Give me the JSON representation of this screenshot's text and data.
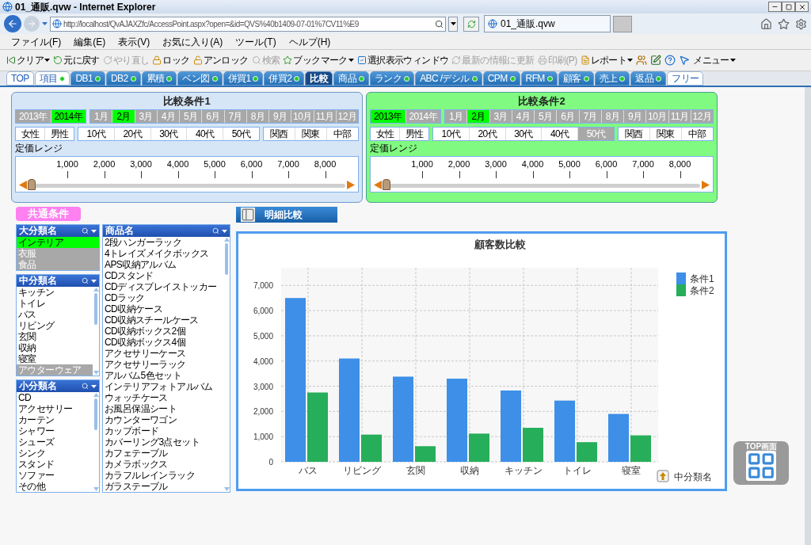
{
  "window": {
    "title": "01_通販.qvw - Internet Explorer"
  },
  "browser": {
    "url": "http://localhost/QvAJAXZfc/AccessPoint.aspx?open=&id=QVS%40b1409-07-01%7CV11%E9",
    "tab_title": "01_通販.qvw",
    "menu": [
      "ファイル(F)",
      "編集(E)",
      "表示(V)",
      "お気に入り(A)",
      "ツール(T)",
      "ヘルプ(H)"
    ]
  },
  "toolbar": [
    {
      "kind": "labeled",
      "label": "クリア",
      "disabled": false,
      "dropdown": true
    },
    {
      "kind": "labeled",
      "label": "元に戻す",
      "disabled": false,
      "dropdown": false
    },
    {
      "kind": "labeled",
      "label": "やり直し",
      "disabled": true,
      "dropdown": false
    },
    {
      "kind": "labeled",
      "label": "ロック",
      "disabled": false,
      "dropdown": false
    },
    {
      "kind": "labeled",
      "label": "アンロック",
      "disabled": false,
      "dropdown": false
    },
    {
      "kind": "labeled",
      "label": "検索",
      "disabled": true,
      "dropdown": false
    },
    {
      "kind": "labeled",
      "label": "ブックマーク",
      "disabled": false,
      "dropdown": true
    },
    {
      "kind": "labeled",
      "label": "選択表示ウィンドウ",
      "disabled": false,
      "dropdown": false
    },
    {
      "kind": "labeled",
      "label": "最新の情報に更新",
      "disabled": true,
      "dropdown": false
    },
    {
      "kind": "labeled",
      "label": "印刷(P)",
      "disabled": true,
      "dropdown": false
    },
    {
      "kind": "labeled",
      "label": "レポート",
      "disabled": false,
      "dropdown": true
    },
    {
      "kind": "icon",
      "disabled": false
    },
    {
      "kind": "icon",
      "disabled": false
    },
    {
      "kind": "icon",
      "disabled": false
    },
    {
      "kind": "icon",
      "disabled": false
    },
    {
      "kind": "labeled",
      "label": "メニュー",
      "disabled": false,
      "dropdown": true
    }
  ],
  "tabs": [
    {
      "label": "TOP",
      "kind": "light",
      "selected": false,
      "dot": false
    },
    {
      "label": "項目",
      "kind": "light",
      "selected": false,
      "dot": true
    },
    {
      "label": "DB1",
      "kind": "blue",
      "selected": false,
      "dot": true
    },
    {
      "label": "DB2",
      "kind": "blue",
      "selected": false,
      "dot": true
    },
    {
      "label": "累積",
      "kind": "blue",
      "selected": false,
      "dot": true
    },
    {
      "label": "ベン図",
      "kind": "blue",
      "selected": false,
      "dot": true
    },
    {
      "label": "併買1",
      "kind": "blue",
      "selected": false,
      "dot": true
    },
    {
      "label": "併買2",
      "kind": "blue",
      "selected": false,
      "dot": true
    },
    {
      "label": "比較",
      "kind": "blue",
      "selected": true,
      "dot": false
    },
    {
      "label": "商品",
      "kind": "blue",
      "selected": false,
      "dot": true
    },
    {
      "label": "ランク",
      "kind": "blue",
      "selected": false,
      "dot": true
    },
    {
      "label": "ABC /デシル",
      "kind": "blue",
      "selected": false,
      "dot": true
    },
    {
      "label": "CPM",
      "kind": "blue",
      "selected": false,
      "dot": true
    },
    {
      "label": "RFM",
      "kind": "blue",
      "selected": false,
      "dot": true
    },
    {
      "label": "顧客",
      "kind": "blue",
      "selected": false,
      "dot": true
    },
    {
      "label": "売上",
      "kind": "blue",
      "selected": false,
      "dot": true
    },
    {
      "label": "返品",
      "kind": "blue",
      "selected": false,
      "dot": true
    },
    {
      "label": "フリー",
      "kind": "light",
      "selected": false,
      "dot": false
    }
  ],
  "conditions": [
    {
      "title": "比較条件1",
      "color": "#d6e6f7",
      "years": [
        {
          "label": "2013年",
          "selected": false,
          "excluded": true
        },
        {
          "label": "2014年",
          "selected": true,
          "excluded": false
        }
      ],
      "months": [
        {
          "label": "1月",
          "selected": false,
          "excluded": true
        },
        {
          "label": "2月",
          "selected": true,
          "excluded": false
        },
        {
          "label": "3月",
          "selected": false,
          "excluded": true
        },
        {
          "label": "4月",
          "selected": false,
          "excluded": true
        },
        {
          "label": "5月",
          "selected": false,
          "excluded": true
        },
        {
          "label": "6月",
          "selected": false,
          "excluded": true
        },
        {
          "label": "7月",
          "selected": false,
          "excluded": true
        },
        {
          "label": "8月",
          "selected": false,
          "excluded": true
        },
        {
          "label": "9月",
          "selected": false,
          "excluded": true
        },
        {
          "label": "10月",
          "selected": false,
          "excluded": true
        },
        {
          "label": "11月",
          "selected": false,
          "excluded": true
        },
        {
          "label": "12月",
          "selected": false,
          "excluded": true
        }
      ],
      "genders": [
        {
          "label": "女性",
          "selected": false,
          "excluded": false
        },
        {
          "label": "男性",
          "selected": false,
          "excluded": false
        }
      ],
      "ages": [
        {
          "label": "10代",
          "selected": false,
          "excluded": false
        },
        {
          "label": "20代",
          "selected": false,
          "excluded": false
        },
        {
          "label": "30代",
          "selected": false,
          "excluded": false
        },
        {
          "label": "40代",
          "selected": false,
          "excluded": false
        },
        {
          "label": "50代",
          "selected": false,
          "excluded": false
        }
      ],
      "regions": [
        {
          "label": "関西",
          "selected": false,
          "excluded": false
        },
        {
          "label": "関東",
          "selected": false,
          "excluded": false
        },
        {
          "label": "中部",
          "selected": false,
          "excluded": false
        }
      ],
      "range_label": "定価レンジ",
      "ticks": [
        "1,000",
        "2,000",
        "3,000",
        "4,000",
        "5,000",
        "6,000",
        "7,000",
        "8,000"
      ],
      "slider": {
        "level": 0
      }
    },
    {
      "title": "比較条件2",
      "color": "#80fa80",
      "years": [
        {
          "label": "2013年",
          "selected": true,
          "excluded": false
        },
        {
          "label": "2014年",
          "selected": false,
          "excluded": true
        }
      ],
      "months": [
        {
          "label": "1月",
          "selected": false,
          "excluded": true
        },
        {
          "label": "2月",
          "selected": true,
          "excluded": false
        },
        {
          "label": "3月",
          "selected": false,
          "excluded": true
        },
        {
          "label": "4月",
          "selected": false,
          "excluded": true
        },
        {
          "label": "5月",
          "selected": false,
          "excluded": true
        },
        {
          "label": "6月",
          "selected": false,
          "excluded": true
        },
        {
          "label": "7月",
          "selected": false,
          "excluded": true
        },
        {
          "label": "8月",
          "selected": false,
          "excluded": true
        },
        {
          "label": "9月",
          "selected": false,
          "excluded": true
        },
        {
          "label": "10月",
          "selected": false,
          "excluded": true
        },
        {
          "label": "11月",
          "selected": false,
          "excluded": true
        },
        {
          "label": "12月",
          "selected": false,
          "excluded": true
        }
      ],
      "genders": [
        {
          "label": "女性",
          "selected": false,
          "excluded": false
        },
        {
          "label": "男性",
          "selected": false,
          "excluded": false
        }
      ],
      "ages": [
        {
          "label": "10代",
          "selected": false,
          "excluded": false
        },
        {
          "label": "20代",
          "selected": false,
          "excluded": false
        },
        {
          "label": "30代",
          "selected": false,
          "excluded": false
        },
        {
          "label": "40代",
          "selected": false,
          "excluded": false
        },
        {
          "label": "50代",
          "selected": false,
          "excluded": true
        }
      ],
      "regions": [
        {
          "label": "関西",
          "selected": false,
          "excluded": false
        },
        {
          "label": "関東",
          "selected": false,
          "excluded": false
        },
        {
          "label": "中部",
          "selected": false,
          "excluded": false
        }
      ],
      "range_label": "定価レンジ",
      "ticks": [
        "1,000",
        "2,000",
        "3,000",
        "4,000",
        "5,000",
        "6,000",
        "7,000",
        "8,000"
      ],
      "slider": {
        "level": 0
      }
    }
  ],
  "common_label": "共通条件",
  "listboxes": [
    {
      "title": "大分類名",
      "scrollbar": false,
      "items": [
        {
          "label": "インテリア",
          "selected": true,
          "excluded": false
        },
        {
          "label": "衣服",
          "selected": false,
          "excluded": true
        },
        {
          "label": "食品",
          "selected": false,
          "excluded": true
        }
      ]
    },
    {
      "title": "中分類名",
      "scrollbar": true,
      "items": [
        {
          "label": "キッチン",
          "selected": false,
          "excluded": false
        },
        {
          "label": "トイレ",
          "selected": false,
          "excluded": false
        },
        {
          "label": "バス",
          "selected": false,
          "excluded": false
        },
        {
          "label": "リビング",
          "selected": false,
          "excluded": false
        },
        {
          "label": "玄関",
          "selected": false,
          "excluded": false
        },
        {
          "label": "収納",
          "selected": false,
          "excluded": false
        },
        {
          "label": "寝室",
          "selected": false,
          "excluded": false
        },
        {
          "label": "アウターウェア",
          "selected": false,
          "excluded": true
        }
      ]
    },
    {
      "title": "小分類名",
      "scrollbar": true,
      "items": [
        {
          "label": "CD",
          "selected": false,
          "excluded": false
        },
        {
          "label": "アクセサリー",
          "selected": false,
          "excluded": false
        },
        {
          "label": "カーテン",
          "selected": false,
          "excluded": false
        },
        {
          "label": "シャワー",
          "selected": false,
          "excluded": false
        },
        {
          "label": "シューズ",
          "selected": false,
          "excluded": false
        },
        {
          "label": "シンク",
          "selected": false,
          "excluded": false
        },
        {
          "label": "スタンド",
          "selected": false,
          "excluded": false
        },
        {
          "label": "ソファー",
          "selected": false,
          "excluded": false
        },
        {
          "label": "その他",
          "selected": false,
          "excluded": false
        }
      ]
    },
    {
      "title": "商品名",
      "scrollbar": true,
      "items": [
        {
          "label": "2段ハンガーラック",
          "selected": false,
          "excluded": false
        },
        {
          "label": "4トレイズメイクボックス",
          "selected": false,
          "excluded": false
        },
        {
          "label": "APS収納アルバム",
          "selected": false,
          "excluded": false
        },
        {
          "label": "CDスタンド",
          "selected": false,
          "excluded": false
        },
        {
          "label": "CDディスプレイストッカー",
          "selected": false,
          "excluded": false
        },
        {
          "label": "CDラック",
          "selected": false,
          "excluded": false
        },
        {
          "label": "CD収納ケース",
          "selected": false,
          "excluded": false
        },
        {
          "label": "CD収納スチールケース",
          "selected": false,
          "excluded": false
        },
        {
          "label": "CD収納ボックス2個",
          "selected": false,
          "excluded": false
        },
        {
          "label": "CD収納ボックス4個",
          "selected": false,
          "excluded": false
        },
        {
          "label": "アクセサリーケース",
          "selected": false,
          "excluded": false
        },
        {
          "label": "アクセサリーラック",
          "selected": false,
          "excluded": false
        },
        {
          "label": "アルバム5色セット",
          "selected": false,
          "excluded": false
        },
        {
          "label": "インテリアフォトアルバム",
          "selected": false,
          "excluded": false
        },
        {
          "label": "ウォッチケース",
          "selected": false,
          "excluded": false
        },
        {
          "label": "お風呂保温シート",
          "selected": false,
          "excluded": false
        },
        {
          "label": "カウンターワゴン",
          "selected": false,
          "excluded": false
        },
        {
          "label": "カップボード",
          "selected": false,
          "excluded": false
        },
        {
          "label": "カバーリング3点セット",
          "selected": false,
          "excluded": false
        },
        {
          "label": "カフェテーブル",
          "selected": false,
          "excluded": false
        },
        {
          "label": "カメラボックス",
          "selected": false,
          "excluded": false
        },
        {
          "label": "カラフルレインラック",
          "selected": false,
          "excluded": false
        },
        {
          "label": "ガラステーブル",
          "selected": false,
          "excluded": false
        }
      ]
    }
  ],
  "detail_button": "明細比較",
  "chart": {
    "drill_label": "中分類名",
    "chart_data": {
      "type": "bar",
      "title": "顧客数比較",
      "categories": [
        "バス",
        "リビング",
        "玄関",
        "収納",
        "キッチン",
        "トイレ",
        "寝室"
      ],
      "series": [
        {
          "name": "条件1",
          "color": "#3d8fe8",
          "values": [
            6500,
            4100,
            3380,
            3300,
            2830,
            2430,
            1900
          ]
        },
        {
          "name": "条件2",
          "color": "#27ae5a",
          "values": [
            2750,
            1080,
            620,
            1120,
            1350,
            780,
            1050
          ]
        }
      ],
      "ylim": [
        0,
        7700
      ],
      "yticks": [
        {
          "value": 0,
          "label": "0"
        },
        {
          "value": 1000,
          "label": "1,000"
        },
        {
          "value": 2000,
          "label": "2,000"
        },
        {
          "value": 3000,
          "label": "3,000"
        },
        {
          "value": 4000,
          "label": "4,000"
        },
        {
          "value": 5000,
          "label": "5,000"
        },
        {
          "value": 6000,
          "label": "6,000"
        },
        {
          "value": 7000,
          "label": "7,000"
        }
      ],
      "grid": true,
      "legend": "right"
    }
  },
  "top_button": "TOP画面"
}
